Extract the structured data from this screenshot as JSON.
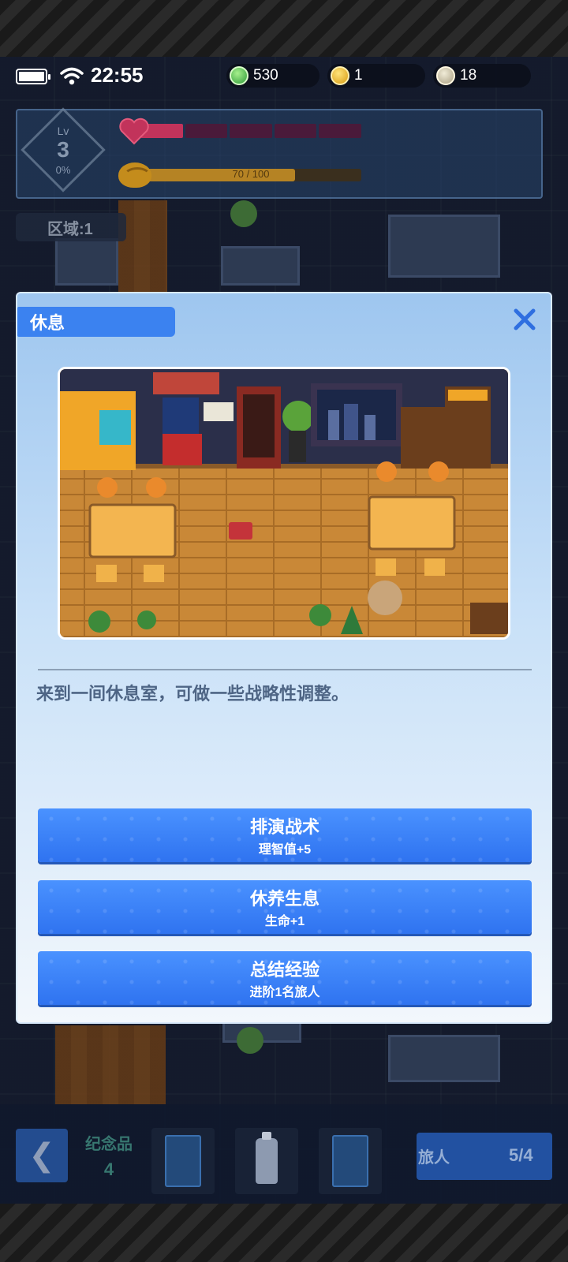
{
  "status_bar": {
    "time": "22:55"
  },
  "currencies": [
    {
      "icon": "green-gem-coin-icon",
      "value": "530"
    },
    {
      "icon": "gold-coin-icon",
      "value": "1"
    },
    {
      "icon": "silver-coin-icon",
      "value": "18"
    }
  ],
  "player": {
    "level_label": "Lv",
    "level": "3",
    "exp_percent_text": "0%",
    "hp_segments_total": 5,
    "hp_segments_filled": 1,
    "sanity_text": "70 / 100",
    "sanity_value": 70,
    "sanity_max": 100
  },
  "area": {
    "label": "区域:1"
  },
  "modal": {
    "title": "休息",
    "description": "来到一间休息室，可做一些战略性调整。",
    "options": [
      {
        "title": "排演战术",
        "desc": "理智值+5"
      },
      {
        "title": "休养生息",
        "desc": "生命+1"
      },
      {
        "title": "总结经验",
        "desc": "进阶1名旅人"
      }
    ]
  },
  "bottom_bar": {
    "souvenir_label": "纪念品",
    "souvenir_count": "4",
    "travelers_label": "旅人",
    "travelers_count": "5/4"
  },
  "colors": {
    "accent_blue": "#3b82f0",
    "hp_red": "#c2335b",
    "sanity_gold": "#b58324"
  }
}
